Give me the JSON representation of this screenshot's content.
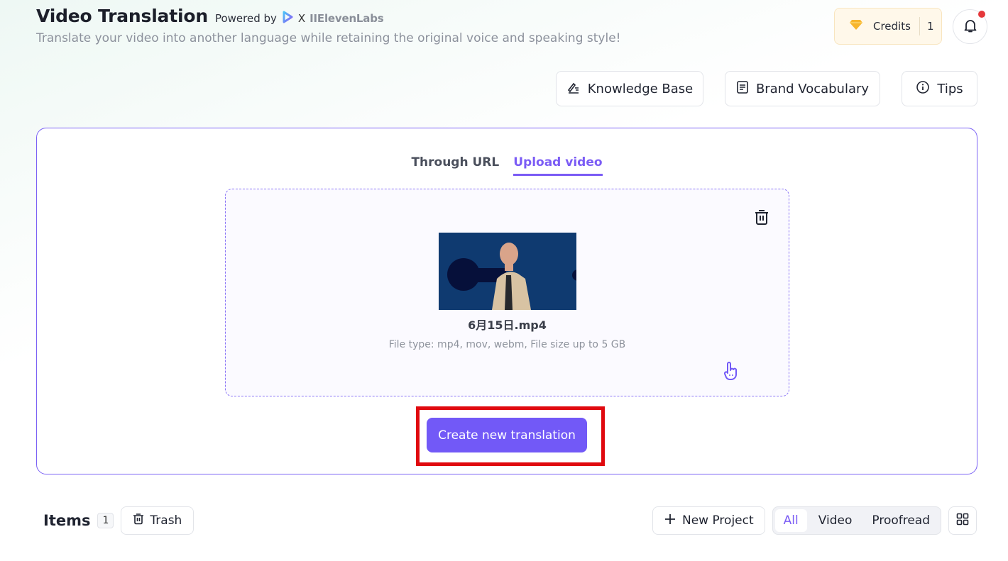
{
  "header": {
    "title": "Video Translation",
    "powered_by": "Powered by",
    "x_sep": "X",
    "partner": "IIElevenLabs",
    "subtitle": "Translate your video into another language while retaining the original voice and speaking style!"
  },
  "credits": {
    "label": "Credits",
    "value": "1"
  },
  "toolbar": {
    "knowledge_base": "Knowledge Base",
    "brand_vocabulary": "Brand Vocabulary",
    "tips": "Tips"
  },
  "upload": {
    "tabs": [
      {
        "label": "Through URL",
        "active": false
      },
      {
        "label": "Upload video",
        "active": true
      }
    ],
    "file_name": "6月15日.mp4",
    "file_hint": "File type: mp4, mov, webm, File size up to 5 GB",
    "create_button": "Create new translation"
  },
  "items": {
    "title": "Items",
    "count": "1",
    "trash": "Trash",
    "new_project": "New Project",
    "filters": [
      {
        "label": "All",
        "active": true
      },
      {
        "label": "Video",
        "active": false
      },
      {
        "label": "Proofread",
        "active": false
      }
    ]
  },
  "colors": {
    "accent": "#7259f7",
    "highlight": "#e0090f",
    "notification": "#e5383b"
  }
}
